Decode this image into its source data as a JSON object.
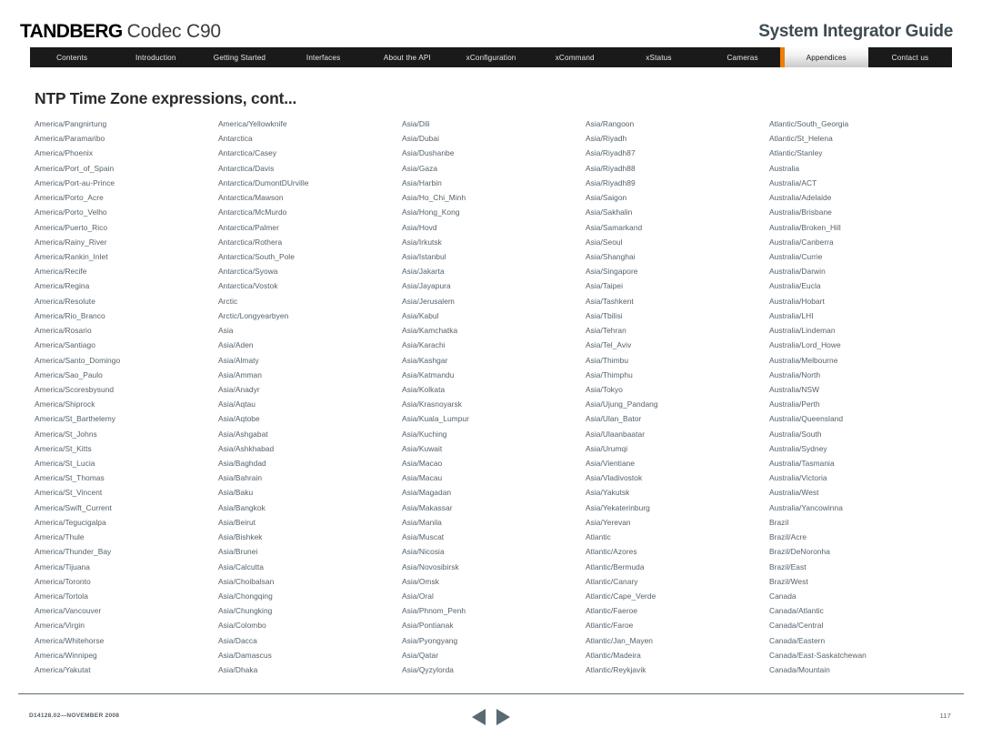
{
  "header": {
    "brand_primary": "TANDBERG",
    "brand_product": "Codec C90",
    "guide_title": "System Integrator Guide",
    "accent_color": "#f07d00"
  },
  "nav": {
    "items": [
      {
        "label": "Contents",
        "active": false
      },
      {
        "label": "Introduction",
        "active": false
      },
      {
        "label": "Getting Started",
        "active": false
      },
      {
        "label": "Interfaces",
        "active": false
      },
      {
        "label": "About the API",
        "active": false
      },
      {
        "label": "xConfiguration",
        "active": false
      },
      {
        "label": "xCommand",
        "active": false
      },
      {
        "label": "xStatus",
        "active": false
      },
      {
        "label": "Cameras",
        "active": false
      },
      {
        "label": "Appendices",
        "active": true
      },
      {
        "label": "Contact us",
        "active": false
      }
    ]
  },
  "page_title": "NTP Time Zone expressions, cont...",
  "columns": [
    [
      "America/Pangnirtung",
      "America/Paramaribo",
      "America/Phoenix",
      "America/Port_of_Spain",
      "America/Port-au-Prince",
      "America/Porto_Acre",
      "America/Porto_Velho",
      "America/Puerto_Rico",
      "America/Rainy_River",
      "America/Rankin_Inlet",
      "America/Recife",
      "America/Regina",
      "America/Resolute",
      "America/Rio_Branco",
      "America/Rosario",
      "America/Santiago",
      "America/Santo_Domingo",
      "America/Sao_Paulo",
      "America/Scoresbysund",
      "America/Shiprock",
      "America/St_Barthelemy",
      "America/St_Johns",
      "America/St_Kitts",
      "America/St_Lucia",
      "America/St_Thomas",
      "America/St_Vincent",
      "America/Swift_Current",
      "America/Tegucigalpa",
      "America/Thule",
      "America/Thunder_Bay",
      "America/Tijuana",
      "America/Toronto",
      "America/Tortola",
      "America/Vancouver",
      "America/Virgin",
      "America/Whitehorse",
      "America/Winnipeg",
      "America/Yakutat"
    ],
    [
      "America/Yellowknife",
      "Antarctica",
      "Antarctica/Casey",
      "Antarctica/Davis",
      "Antarctica/DumontDUrville",
      "Antarctica/Mawson",
      "Antarctica/McMurdo",
      "Antarctica/Palmer",
      "Antarctica/Rothera",
      "Antarctica/South_Pole",
      "Antarctica/Syowa",
      "Antarctica/Vostok",
      "Arctic",
      "Arctic/Longyearbyen",
      "Asia",
      "Asia/Aden",
      "Asia/Almaty",
      "Asia/Amman",
      "Asia/Anadyr",
      "Asia/Aqtau",
      "Asia/Aqtobe",
      "Asia/Ashgabat",
      "Asia/Ashkhabad",
      "Asia/Baghdad",
      "Asia/Bahrain",
      "Asia/Baku",
      "Asia/Bangkok",
      "Asia/Beirut",
      "Asia/Bishkek",
      "Asia/Brunei",
      "Asia/Calcutta",
      "Asia/Choibalsan",
      "Asia/Chongqing",
      "Asia/Chungking",
      "Asia/Colombo",
      "Asia/Dacca",
      "Asia/Damascus",
      "Asia/Dhaka"
    ],
    [
      "Asia/Dili",
      "Asia/Dubai",
      "Asia/Dushanbe",
      "Asia/Gaza",
      "Asia/Harbin",
      "Asia/Ho_Chi_Minh",
      "Asia/Hong_Kong",
      "Asia/Hovd",
      "Asia/Irkutsk",
      "Asia/Istanbul",
      "Asia/Jakarta",
      "Asia/Jayapura",
      "Asia/Jerusalem",
      "Asia/Kabul",
      "Asia/Kamchatka",
      "Asia/Karachi",
      "Asia/Kashgar",
      "Asia/Katmandu",
      "Asia/Kolkata",
      "Asia/Krasnoyarsk",
      "Asia/Kuala_Lumpur",
      "Asia/Kuching",
      "Asia/Kuwait",
      "Asia/Macao",
      "Asia/Macau",
      "Asia/Magadan",
      "Asia/Makassar",
      "Asia/Manila",
      "Asia/Muscat",
      "Asia/Nicosia",
      "Asia/Novosibirsk",
      "Asia/Omsk",
      "Asia/Oral",
      "Asia/Phnom_Penh",
      "Asia/Pontianak",
      "Asia/Pyongyang",
      "Asia/Qatar",
      "Asia/Qyzylorda"
    ],
    [
      "Asia/Rangoon",
      "Asia/Riyadh",
      "Asia/Riyadh87",
      "Asia/Riyadh88",
      "Asia/Riyadh89",
      "Asia/Saigon",
      "Asia/Sakhalin",
      "Asia/Samarkand",
      "Asia/Seoul",
      "Asia/Shanghai",
      "Asia/Singapore",
      "Asia/Taipei",
      "Asia/Tashkent",
      "Asia/Tbilisi",
      "Asia/Tehran",
      "Asia/Tel_Aviv",
      "Asia/Thimbu",
      "Asia/Thimphu",
      "Asia/Tokyo",
      "Asia/Ujung_Pandang",
      "Asia/Ulan_Bator",
      "Asia/Ulaanbaatar",
      "Asia/Urumqi",
      "Asia/Vientiane",
      "Asia/Vladivostok",
      "Asia/Yakutsk",
      "Asia/Yekaterinburg",
      "Asia/Yerevan",
      "Atlantic",
      "Atlantic/Azores",
      "Atlantic/Bermuda",
      "Atlantic/Canary",
      "Atlantic/Cape_Verde",
      "Atlantic/Faeroe",
      "Atlantic/Faroe",
      "Atlantic/Jan_Mayen",
      "Atlantic/Madeira",
      "Atlantic/Reykjavik"
    ],
    [
      "Atlantic/South_Georgia",
      "Atlantic/St_Helena",
      "Atlantic/Stanley",
      "Australia",
      "Australia/ACT",
      "Australia/Adelaide",
      "Australia/Brisbane",
      "Australia/Broken_Hill",
      "Australia/Canberra",
      "Australia/Currie",
      "Australia/Darwin",
      "Australia/Eucla",
      "Australia/Hobart",
      "Australia/LHI",
      "Australia/Lindeman",
      "Australia/Lord_Howe",
      "Australia/Melbourne",
      "Australia/North",
      "Australia/NSW",
      "Australia/Perth",
      "Australia/Queensland",
      "Australia/South",
      "Australia/Sydney",
      "Australia/Tasmania",
      "Australia/Victoria",
      "Australia/West",
      "Australia/Yancowinna",
      "Brazil",
      "Brazil/Acre",
      "Brazil/DeNoronha",
      "Brazil/East",
      "Brazil/West",
      "Canada",
      "Canada/Atlantic",
      "Canada/Central",
      "Canada/Eastern",
      "Canada/East-Saskatchewan",
      "Canada/Mountain"
    ]
  ],
  "footer": {
    "doc_ref": "D14128.02—NOVEMBER 2008",
    "page_number": "117",
    "prev_label": "prev-page",
    "next_label": "next-page"
  }
}
